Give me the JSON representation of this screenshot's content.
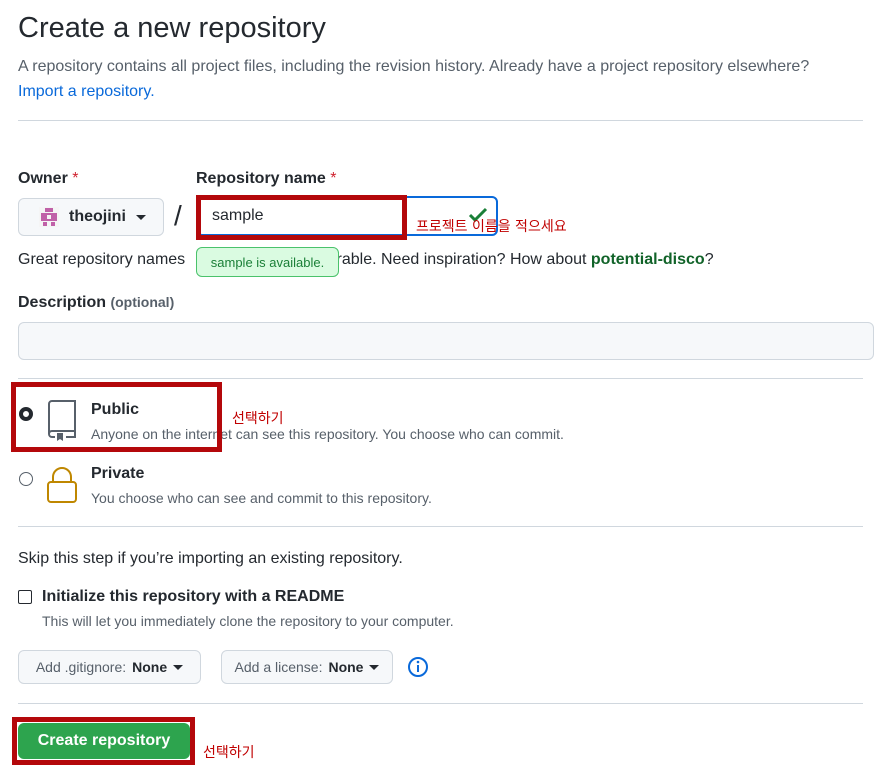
{
  "header": {
    "title": "Create a new repository",
    "subtitle": "A repository contains all project files, including the revision history. Already have a project repository elsewhere?",
    "import_link": "Import a repository."
  },
  "owner": {
    "label": "Owner",
    "required_mark": "*",
    "value": "theojini"
  },
  "separator": "/",
  "repo_name": {
    "label": "Repository name",
    "required_mark": "*",
    "value": "sample",
    "annotation": "프로젝트 이름을 적으세요",
    "availability": "sample is available."
  },
  "suggestion": {
    "prefix": "Great repository names ",
    "middle": "orable. Need inspiration? How about ",
    "name": "potential-disco",
    "suffix": "?"
  },
  "description": {
    "label": "Description",
    "optional": "(optional)",
    "value": ""
  },
  "visibility": {
    "selected": "public",
    "annotation": "선택하기",
    "public": {
      "title": "Public",
      "desc": "Anyone on the internet can see this repository. You choose who can commit."
    },
    "private": {
      "title": "Private",
      "desc": "You choose who can see and commit to this repository."
    }
  },
  "init": {
    "skip_text": "Skip this step if you’re importing an existing repository.",
    "readme_label": "Initialize this repository with a README",
    "readme_desc": "This will let you immediately clone the repository to your computer.",
    "readme_checked": false
  },
  "gitignore": {
    "label": "Add .gitignore:",
    "value": "None"
  },
  "license": {
    "label": "Add a license:",
    "value": "None"
  },
  "create": {
    "label": "Create repository",
    "annotation": "선택하기"
  },
  "colors": {
    "primary_green": "#2da44e",
    "annotation_red": "#b4080b",
    "link_blue": "#0969da"
  }
}
